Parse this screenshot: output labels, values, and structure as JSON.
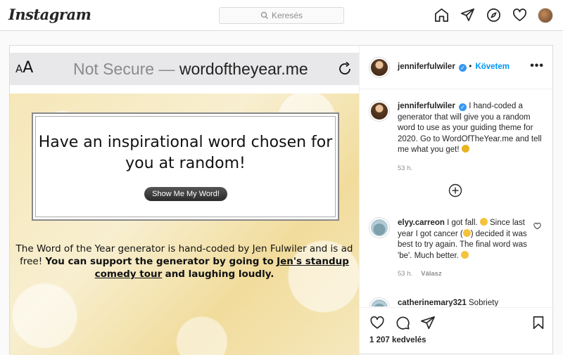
{
  "app": {
    "logo": "Instagram"
  },
  "search": {
    "placeholder": "Keresés"
  },
  "nav_icons": [
    "home-icon",
    "direct-icon",
    "explore-icon",
    "activity-heart-icon",
    "profile-avatar"
  ],
  "post_image": {
    "browser": {
      "aa_label": "AA",
      "not_secure": "Not Secure —",
      "domain": "wordoftheyear.me"
    },
    "card_title": "Have an inspirational word chosen for you at random!",
    "button": "Show Me My Word!",
    "desc_plain": "The Word of the Year generator is hand-coded by Jen Fulwiler and is ad free!",
    "desc_bold": "You can support the generator by going to",
    "desc_link": "Jen's standup comedy tour",
    "desc_end": "and laughing loudly."
  },
  "header": {
    "username": "jenniferfulwiler",
    "follow": "Követem",
    "more": "•••"
  },
  "caption": {
    "username": "jenniferfulwiler",
    "text": "I hand-coded a generator that will give you a random word to use as your guiding theme for 2020. Go to WordOfTheYear.me and tell me what you get!",
    "time": "53 h."
  },
  "comments": [
    {
      "username": "elyy.carreon",
      "text_a": "I got fall.",
      "text_b": "Since last year I got cancer (",
      "text_c": ") decided it was best to try again. The final word was 'be'. Much better.",
      "time": "53 h.",
      "reply": "Válasz"
    },
    {
      "username": "catherinemary321",
      "text": "Sobriety"
    }
  ],
  "likes": "1 207 kedvelés",
  "colors": {
    "accent": "#0095f6",
    "verified": "#3897f0",
    "border": "#dbdbdb"
  }
}
